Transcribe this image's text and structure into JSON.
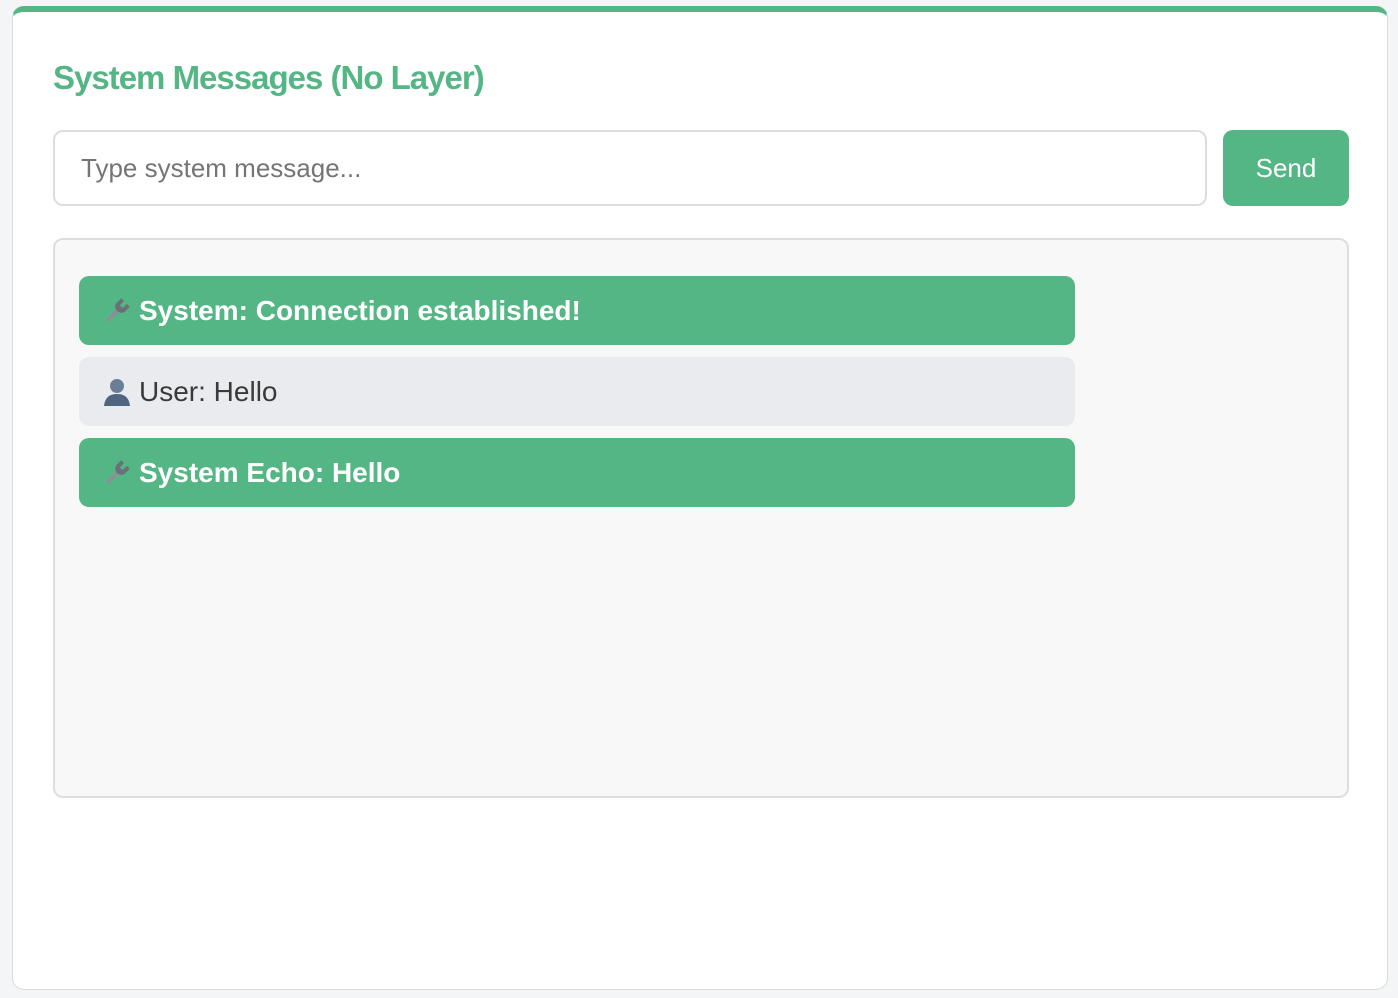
{
  "panel": {
    "title": "System Messages (No Layer)"
  },
  "composer": {
    "placeholder": "Type system message...",
    "value": "",
    "send_label": "Send"
  },
  "messages": [
    {
      "type": "system",
      "icon": "wrench-icon",
      "text": "System: Connection established!"
    },
    {
      "type": "user",
      "icon": "user-icon",
      "text": "User: Hello"
    },
    {
      "type": "system",
      "icon": "wrench-icon",
      "text": "System Echo: Hello"
    }
  ],
  "colors": {
    "accent": "#55b685",
    "user_bubble": "#e9ebef",
    "log_background": "#f8f8f8"
  }
}
